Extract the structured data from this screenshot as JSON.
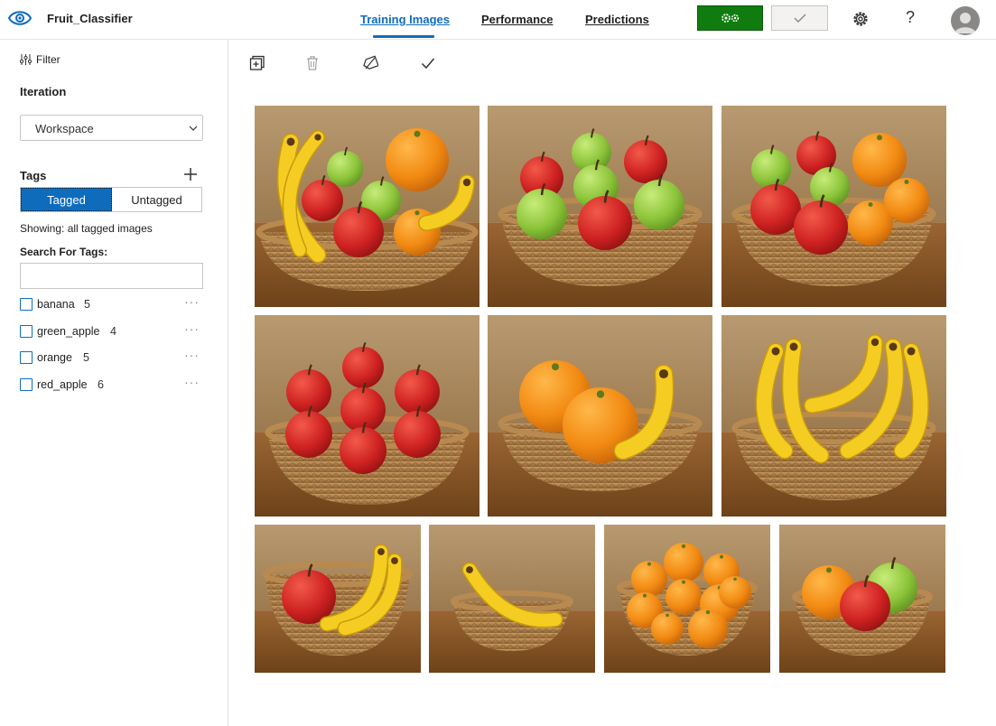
{
  "app": {
    "name": "Fruit_Classifier"
  },
  "nav": {
    "tabs": [
      {
        "label": "Training Images",
        "active": true
      },
      {
        "label": "Performance",
        "active": false
      },
      {
        "label": "Predictions",
        "active": false
      }
    ],
    "train_icon": "gears-icon",
    "quick_test_icon": "checkmark-icon",
    "settings_icon": "gear-icon",
    "help_label": "?"
  },
  "sidebar": {
    "filter_label": "Filter",
    "iteration_title": "Iteration",
    "iteration_value": "Workspace",
    "tags_title": "Tags",
    "toggle": {
      "tagged": "Tagged",
      "untagged": "Untagged",
      "selected": "Tagged"
    },
    "showing_text": "Showing: all tagged images",
    "search_label": "Search For Tags:",
    "search_value": "",
    "tags": [
      {
        "name": "banana",
        "count": "5"
      },
      {
        "name": "green_apple",
        "count": "4"
      },
      {
        "name": "orange",
        "count": "5"
      },
      {
        "name": "red_apple",
        "count": "6"
      }
    ]
  },
  "toolbar": {
    "icons": [
      "add-images-icon",
      "delete-icon",
      "untag-icon",
      "select-checkmark-icon"
    ]
  },
  "images": [
    {
      "content": "bananas, green apples, red apples, orange"
    },
    {
      "content": "green apples, red apples"
    },
    {
      "content": "red apples, green apples, oranges"
    },
    {
      "content": "red apples"
    },
    {
      "content": "oranges, banana"
    },
    {
      "content": "bananas"
    },
    {
      "content": "red apple, bananas"
    },
    {
      "content": "banana"
    },
    {
      "content": "oranges"
    },
    {
      "content": "orange, red apple, green apple"
    }
  ],
  "colors": {
    "accent": "#0f6cbd",
    "train_button": "#107c10",
    "banana": "#f2c318",
    "orange": "#f28a14",
    "red_apple": "#d42a2a",
    "green_apple": "#8dc43c",
    "basket": "#b88a52",
    "table": "#8a5a2c",
    "wall": "#a98a62"
  }
}
